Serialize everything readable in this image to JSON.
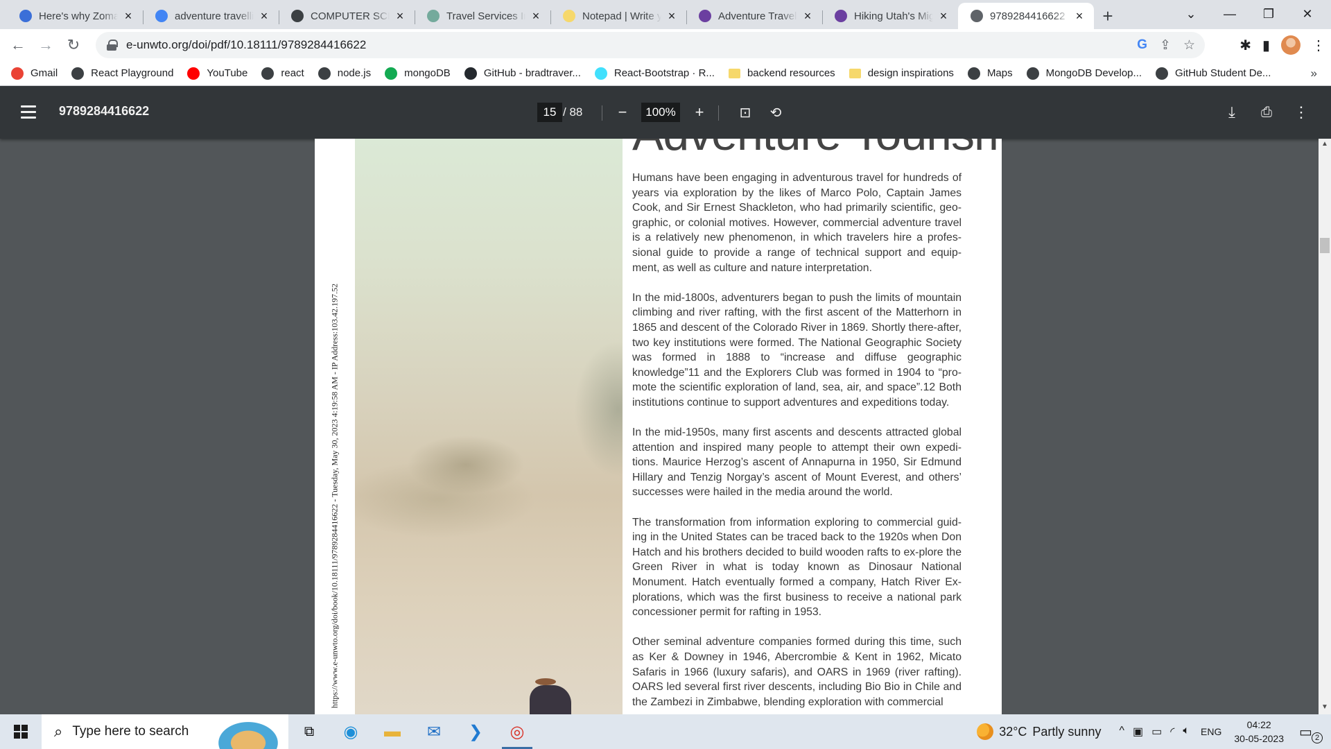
{
  "browser": {
    "tabs": [
      {
        "title": "Here's why Zomato",
        "favicon": "news-icon",
        "fav_color": "#3b6fd8",
        "active": false
      },
      {
        "title": "adventure travelling",
        "favicon": "google-icon",
        "fav_color": "#4285f4",
        "active": false
      },
      {
        "title": "COMPUTER SCIENCE",
        "favicon": "globe-icon",
        "fav_color": "#3c4043",
        "active": false
      },
      {
        "title": "Travel Services Inc",
        "favicon": "openai-icon",
        "fav_color": "#74aa9c",
        "active": false
      },
      {
        "title": "Notepad | Write your",
        "favicon": "notepad-icon",
        "fav_color": "#f6d86b",
        "active": false
      },
      {
        "title": "Adventure Travel",
        "favicon": "copilot-icon",
        "fav_color": "#6b3fa0",
        "active": false
      },
      {
        "title": "Hiking Utah's Mighty",
        "favicon": "copilot-icon",
        "fav_color": "#6b3fa0",
        "active": false
      },
      {
        "title": "9789284416622",
        "favicon": "pdf-icon",
        "fav_color": "#5f6368",
        "active": true
      }
    ],
    "new_tab_symbol": "+",
    "url": "e-unwto.org/doi/pdf/10.18111/9789284416622",
    "bookmarks": [
      {
        "label": "Gmail",
        "icon": "gmail-icon"
      },
      {
        "label": "React Playground",
        "icon": "globe-icon"
      },
      {
        "label": "YouTube",
        "icon": "youtube-icon"
      },
      {
        "label": "react",
        "icon": "globe-icon"
      },
      {
        "label": "node.js",
        "icon": "globe-icon"
      },
      {
        "label": "mongoDB",
        "icon": "mongodb-icon"
      },
      {
        "label": "GitHub - bradtraver...",
        "icon": "github-icon"
      },
      {
        "label": "React-Bootstrap · R...",
        "icon": "react-bootstrap-icon"
      },
      {
        "label": "backend resources",
        "icon": "folder-icon"
      },
      {
        "label": "design inspirations",
        "icon": "folder-icon"
      },
      {
        "label": "Maps",
        "icon": "globe-icon"
      },
      {
        "label": "MongoDB Develop...",
        "icon": "globe-icon"
      },
      {
        "label": "GitHub Student De...",
        "icon": "globe-icon"
      }
    ],
    "bookmarks_more": "»"
  },
  "pdf": {
    "title": "9789284416622",
    "current_page": "15",
    "page_separator": "/",
    "total_pages": "88",
    "zoom": "100%",
    "side_stamp": "https://www.e-unwto.org/doi/book/10.18111/9789284416622 - Tuesday, May 30, 2023 4:19:58 AM - IP Address:103.42.197.52",
    "heading_fragment": "Adventure Tourism",
    "paragraphs": [
      "Humans have been engaging in adventurous travel for hundreds of years via exploration by the likes of Marco Polo, Captain James Cook, and Sir Ernest Shackleton, who had primarily scientific, geo-graphic, or colonial motives. However, commercial adventure travel is a relatively new phenomenon, in which travelers hire a profes-sional guide to provide a range of technical support and equip-ment, as well as culture and nature interpretation.",
      "In the mid-1800s, adventurers began to push the limits of mountain climbing and river rafting, with the first ascent of the Matterhorn in 1865 and descent of the Colorado River in 1869. Shortly there-after, two key institutions were formed. The National Geographic Society was formed in 1888 to “increase and diffuse geographic knowledge”11 and the Explorers Club was formed in 1904 to “pro-mote the scientific exploration of land, sea, air, and space”.12 Both institutions continue to support adventures and expeditions today.",
      "In the mid-1950s, many first ascents and descents attracted global attention and inspired many people to attempt their own expedi-tions. Maurice Herzog’s ascent of Annapurna in 1950, Sir Edmund Hillary and Tenzig Norgay’s ascent of Mount Everest, and others’ successes were hailed in the media around the world.",
      "The transformation from information exploring to commercial guid-ing in the United States can be traced back to the 1920s when Don Hatch and his brothers decided to build wooden rafts to ex-plore the Green River in what is today known as Dinosaur National Monument. Hatch eventually formed a company, Hatch River Ex-plorations, which was the first business to receive a national park concessioner permit for rafting in 1953.",
      "Other seminal adventure companies formed during this time, such as Ker & Downey in 1946,  Abercrombie & Kent in 1962, Micato Safaris in 1966 (luxury safaris), and OARS in 1969 (river rafting). OARS led several first river descents, including Bio Bio in Chile and the Zambezi in Zimbabwe, blending exploration with commercial"
    ]
  },
  "taskbar": {
    "search_placeholder": "Type here to search",
    "weather_temp": "32°C",
    "weather_desc": "Partly sunny",
    "language": "ENG",
    "time": "04:22",
    "date": "30-05-2023",
    "notification_count": "2"
  }
}
